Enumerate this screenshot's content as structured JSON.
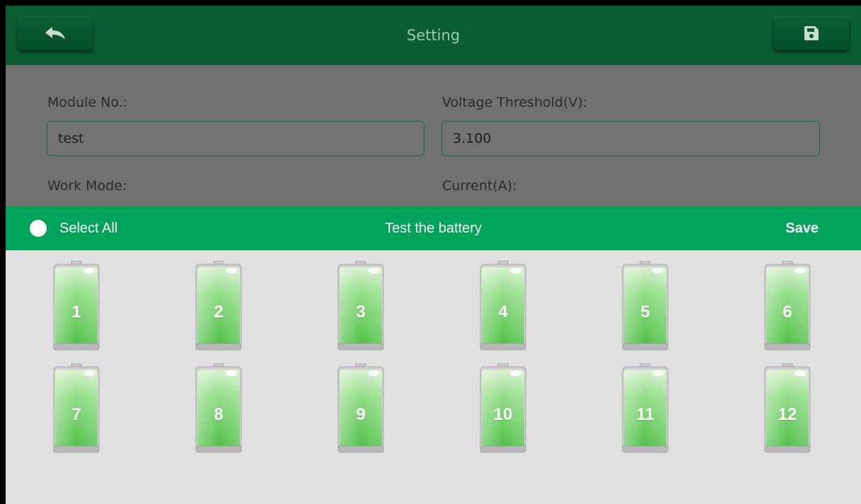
{
  "header": {
    "title": "Setting",
    "back_icon": "reply-arrow-icon",
    "save_icon": "floppy-disk-icon"
  },
  "form": {
    "module_label": "Module No.:",
    "module_value": "test",
    "voltage_label": "Voltage Threshold(V):",
    "voltage_value": "3.100",
    "work_mode_label": "Work Mode:",
    "current_label": "Current(A):"
  },
  "dialog": {
    "select_all_label": "Select All",
    "title": "Test the battery",
    "save_label": "Save",
    "batteries": [
      {
        "label": "1"
      },
      {
        "label": "2"
      },
      {
        "label": "3"
      },
      {
        "label": "4"
      },
      {
        "label": "5"
      },
      {
        "label": "6"
      },
      {
        "label": "7"
      },
      {
        "label": "8"
      },
      {
        "label": "9"
      },
      {
        "label": "10"
      },
      {
        "label": "11"
      },
      {
        "label": "12"
      }
    ]
  },
  "colors": {
    "header_bg": "#085a31",
    "dialog_bar": "#00a35a",
    "battery_fill": "#5cc94b"
  }
}
